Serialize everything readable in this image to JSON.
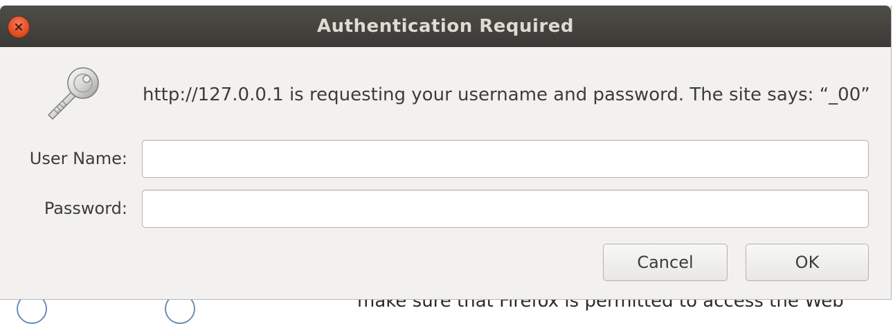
{
  "dialog": {
    "title": "Authentication Required",
    "message": "http://127.0.0.1 is requesting your username and password. The site says: “_00”",
    "username_label": "User Name:",
    "username_value": "",
    "password_label": "Password:",
    "password_value": "",
    "cancel_label": "Cancel",
    "ok_label": "OK",
    "icons": {
      "close": "close-icon",
      "key": "key-icon"
    }
  },
  "background": {
    "partial_text": "make sure that Firefox is permitted to access the Web"
  },
  "colors": {
    "titlebar": "#3b3a36",
    "title_text": "#dfdbd2",
    "close_button": "#e0471c",
    "dialog_bg": "#f2f1f0"
  }
}
